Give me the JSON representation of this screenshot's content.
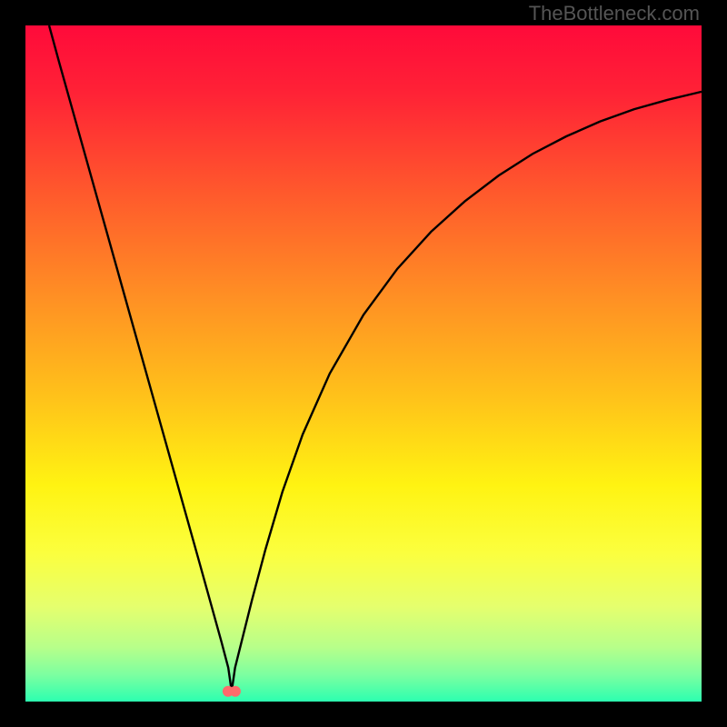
{
  "attribution": "TheBottleneck.com",
  "chart_data": {
    "type": "line",
    "title": "",
    "xlabel": "",
    "ylabel": "",
    "xlim": [
      0,
      1
    ],
    "ylim": [
      0,
      1
    ],
    "gradient_stops": [
      {
        "offset": 0.0,
        "color": "#ff0a3a"
      },
      {
        "offset": 0.1,
        "color": "#ff2236"
      },
      {
        "offset": 0.25,
        "color": "#ff5a2c"
      },
      {
        "offset": 0.4,
        "color": "#ff8f24"
      },
      {
        "offset": 0.55,
        "color": "#ffc21a"
      },
      {
        "offset": 0.68,
        "color": "#fff312"
      },
      {
        "offset": 0.78,
        "color": "#fbff3e"
      },
      {
        "offset": 0.86,
        "color": "#e5ff6e"
      },
      {
        "offset": 0.92,
        "color": "#b7ff8a"
      },
      {
        "offset": 0.96,
        "color": "#7dffa0"
      },
      {
        "offset": 1.0,
        "color": "#2cffb0"
      }
    ],
    "minimum_marker": {
      "x": 0.305,
      "y": 0.985,
      "color": "#ff6b6b"
    },
    "series": [
      {
        "name": "bottleneck-curve",
        "x": [
          0.035,
          0.05,
          0.08,
          0.11,
          0.14,
          0.17,
          0.2,
          0.23,
          0.255,
          0.275,
          0.29,
          0.3,
          0.305,
          0.31,
          0.32,
          0.335,
          0.355,
          0.38,
          0.41,
          0.45,
          0.5,
          0.55,
          0.6,
          0.65,
          0.7,
          0.75,
          0.8,
          0.85,
          0.9,
          0.95,
          1.0
        ],
        "y": [
          1.0,
          0.945,
          0.838,
          0.731,
          0.624,
          0.517,
          0.41,
          0.303,
          0.214,
          0.142,
          0.088,
          0.05,
          0.015,
          0.05,
          0.09,
          0.15,
          0.225,
          0.31,
          0.395,
          0.485,
          0.572,
          0.64,
          0.695,
          0.74,
          0.778,
          0.81,
          0.836,
          0.858,
          0.876,
          0.89,
          0.902
        ]
      }
    ]
  }
}
